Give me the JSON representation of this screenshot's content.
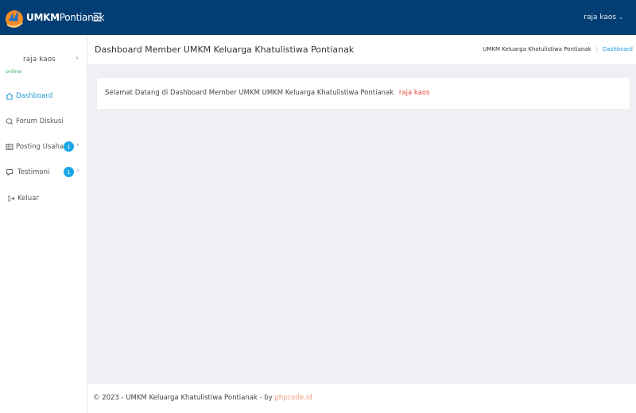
{
  "topbar": {
    "brand_bold": "UMKM",
    "brand_rest": "Pontianak",
    "user_name": "raja kaos"
  },
  "sidebar": {
    "user_name": "raja kaos",
    "status": "online",
    "items": [
      {
        "label": "Dashboard",
        "icon": "home-icon",
        "active": true
      },
      {
        "label": "Forum Diskusi",
        "icon": "chat-icon"
      },
      {
        "label": "Posting Usaha",
        "icon": "grid-icon",
        "badge": "1"
      },
      {
        "label": "Testimoni",
        "icon": "comment-icon",
        "badge": "1"
      },
      {
        "label": "Keluar",
        "icon": "logout-icon"
      }
    ]
  },
  "header": {
    "title": "Dashboard Member UMKM Keluarga Khatulistiwa Pontianak",
    "breadcrumb": [
      "UMKM Keluarga Khatulistiwa Pontianak",
      "Dashboard"
    ]
  },
  "main": {
    "welcome_text": "Selamat Datang di Dashboard Member UMKM UMKM Keluarga Khatulistiwa Pontianak",
    "welcome_name": "raja kaos"
  },
  "footer": {
    "text": "© 2023 - UMKM Keluarga Khatulistiwa Pontianak - by ",
    "link": "phpcode.id"
  },
  "colors": {
    "topbar": "#023e73",
    "accent": "#1e9bd7",
    "badge": "#1da7e6",
    "online": "#27ae60",
    "highlight": "#e74c3c",
    "footer_link": "#f39c7b"
  }
}
